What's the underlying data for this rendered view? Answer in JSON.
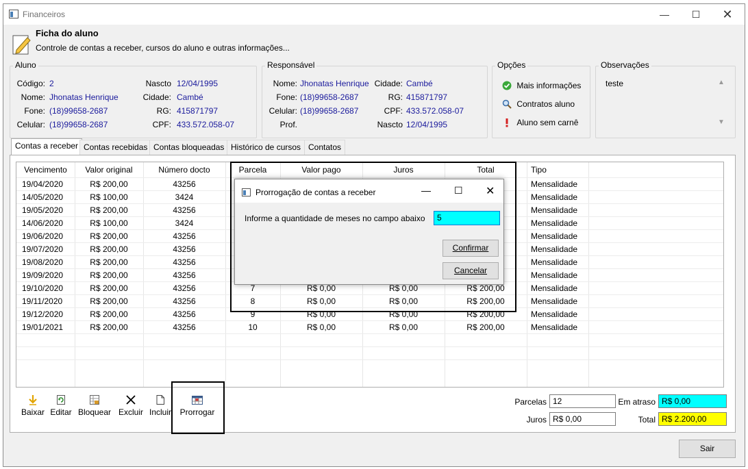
{
  "window": {
    "title": "Financeiros"
  },
  "header": {
    "title": "Ficha do aluno",
    "subtitle": "Controle de contas a receber, cursos do aluno e outras informações..."
  },
  "aluno": {
    "group_label": "Aluno",
    "codigo_label": "Código:",
    "codigo": "2",
    "nome_label": "Nome:",
    "nome": "Jhonatas Henrique",
    "fone_label": "Fone:",
    "fone": "(18)99658-2687",
    "celular_label": "Celular:",
    "celular": "(18)99658-2687",
    "nascto_label": "Nascto",
    "nascto": "12/04/1995",
    "cidade_label": "Cidade:",
    "cidade": "Cambé",
    "rg_label": "RG:",
    "rg": "415871797",
    "cpf_label": "CPF:",
    "cpf": "433.572.058-07"
  },
  "responsavel": {
    "group_label": "Responsável",
    "nome_label": "Nome:",
    "nome": "Jhonatas Henrique",
    "fone_label": "Fone:",
    "fone": "(18)99658-2687",
    "celular_label": "Celular:",
    "celular": "(18)99658-2687",
    "prof_label": "Prof.",
    "cidade_label": "Cidade:",
    "cidade": "Cambé",
    "rg_label": "RG:",
    "rg": "415871797",
    "cpf_label": "CPF:",
    "cpf": "433.572.058-07",
    "nascto_label": "Nascto",
    "nascto": "12/04/1995"
  },
  "opcoes": {
    "group_label": "Opções",
    "items": [
      "Mais informações",
      "Contratos aluno",
      "Aluno sem carnê"
    ]
  },
  "observacoes": {
    "group_label": "Observações",
    "text": "teste"
  },
  "tabs": [
    "Contas a receber",
    "Contas recebidas",
    "Contas bloqueadas",
    "Histórico de cursos",
    "Contatos"
  ],
  "grid": {
    "headers": [
      "Vencimento",
      "Valor original",
      "Número docto",
      "Parcela",
      "Valor pago",
      "Juros",
      "Total",
      "Tipo"
    ],
    "rows": [
      {
        "vencimento": "19/04/2020",
        "valor": "R$ 200,00",
        "docto": "43256",
        "parcela": "",
        "pago": "",
        "juros": "",
        "total": "",
        "tipo": "Mensalidade"
      },
      {
        "vencimento": "14/05/2020",
        "valor": "R$ 100,00",
        "docto": "3424",
        "parcela": "",
        "pago": "",
        "juros": "",
        "total": "",
        "tipo": "Mensalidade"
      },
      {
        "vencimento": "19/05/2020",
        "valor": "R$ 200,00",
        "docto": "43256",
        "parcela": "",
        "pago": "",
        "juros": "",
        "total": "",
        "tipo": "Mensalidade"
      },
      {
        "vencimento": "14/06/2020",
        "valor": "R$ 100,00",
        "docto": "3424",
        "parcela": "",
        "pago": "",
        "juros": "",
        "total": "",
        "tipo": "Mensalidade"
      },
      {
        "vencimento": "19/06/2020",
        "valor": "R$ 200,00",
        "docto": "43256",
        "parcela": "",
        "pago": "",
        "juros": "",
        "total": "",
        "tipo": "Mensalidade"
      },
      {
        "vencimento": "19/07/2020",
        "valor": "R$ 200,00",
        "docto": "43256",
        "parcela": "",
        "pago": "",
        "juros": "",
        "total": "",
        "tipo": "Mensalidade"
      },
      {
        "vencimento": "19/08/2020",
        "valor": "R$ 200,00",
        "docto": "43256",
        "parcela": "",
        "pago": "",
        "juros": "",
        "total": "",
        "tipo": "Mensalidade"
      },
      {
        "vencimento": "19/09/2020",
        "valor": "R$ 200,00",
        "docto": "43256",
        "parcela": "",
        "pago": "",
        "juros": "",
        "total": "",
        "tipo": "Mensalidade"
      },
      {
        "vencimento": "19/10/2020",
        "valor": "R$ 200,00",
        "docto": "43256",
        "parcela": "7",
        "pago": "R$ 0,00",
        "juros": "R$ 0,00",
        "total": "R$ 200,00",
        "tipo": "Mensalidade"
      },
      {
        "vencimento": "19/11/2020",
        "valor": "R$ 200,00",
        "docto": "43256",
        "parcela": "8",
        "pago": "R$ 0,00",
        "juros": "R$ 0,00",
        "total": "R$ 200,00",
        "tipo": "Mensalidade"
      },
      {
        "vencimento": "19/12/2020",
        "valor": "R$ 200,00",
        "docto": "43256",
        "parcela": "9",
        "pago": "R$ 0,00",
        "juros": "R$ 0,00",
        "total": "R$ 200,00",
        "tipo": "Mensalidade"
      },
      {
        "vencimento": "19/01/2021",
        "valor": "R$ 200,00",
        "docto": "43256",
        "parcela": "10",
        "pago": "R$ 0,00",
        "juros": "R$ 0,00",
        "total": "R$ 200,00",
        "tipo": "Mensalidade"
      }
    ]
  },
  "toolbar": {
    "baixar": "Baixar",
    "editar": "Editar",
    "bloquear": "Bloquear",
    "excluir": "Excluir",
    "incluir": "Incluir",
    "prorrogar": "Prorrogar"
  },
  "summary": {
    "parcelas_label": "Parcelas",
    "parcelas": "12",
    "juros_label": "Juros",
    "juros": "R$ 0,00",
    "atraso_label": "Em atraso",
    "atraso": "R$ 0,00",
    "total_label": "Total",
    "total": "R$ 2.200,00",
    "atraso_color": "#00ffff",
    "total_color": "#ffff00"
  },
  "sair_label": "Sair",
  "dialog": {
    "title": "Prorrogação de contas a receber",
    "prompt": "Informe a quantidade de meses no campo abaixo",
    "input_value": "5",
    "input_color": "#00ffff",
    "confirm_label": "Confirmar",
    "cancel_label": "Cancelar"
  }
}
